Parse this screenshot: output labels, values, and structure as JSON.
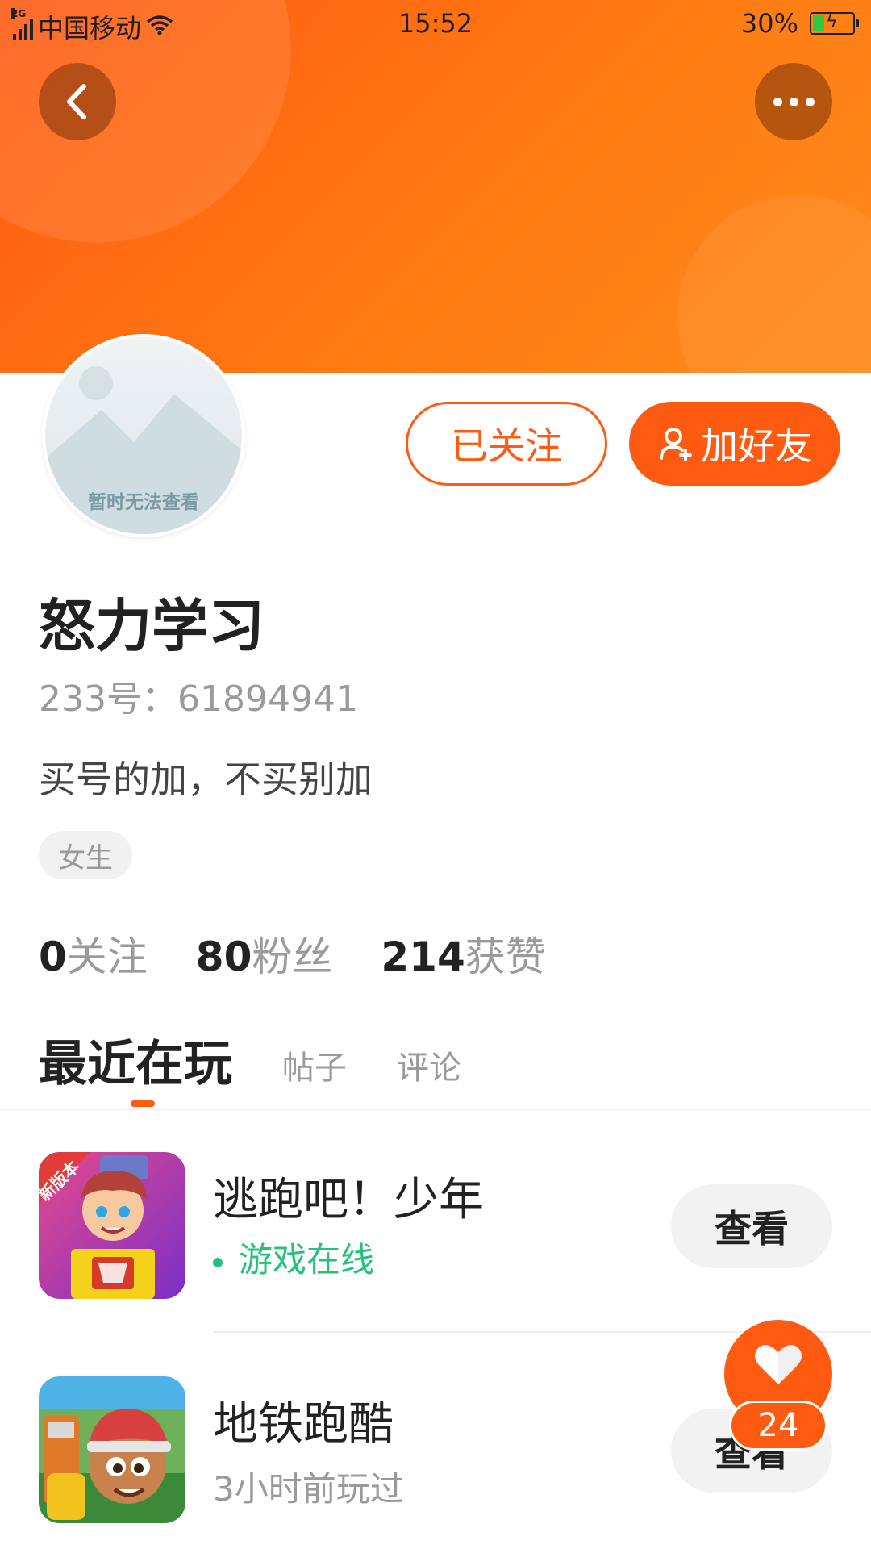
{
  "status_bar": {
    "network": "2G",
    "carrier": "中国移动",
    "time": "15:52",
    "battery": "30%"
  },
  "header": {
    "back_icon": "chevron-left-icon",
    "more_icon": "more-dots-icon",
    "color_start": "#ff5a12",
    "color_end": "#ff8c1e"
  },
  "profile": {
    "avatar_placeholder": "暂时无法查看",
    "follow_button": "已关注",
    "add_friend_button": "加好友",
    "username": "怒力学习",
    "uid": "233号：61894941",
    "bio": "买号的加，不买别加",
    "tag": "女生",
    "stats": [
      {
        "num": "0",
        "label": "关注"
      },
      {
        "num": "80",
        "label": "粉丝"
      },
      {
        "num": "214",
        "label": "获赞"
      }
    ]
  },
  "tabs": {
    "active": "最近在玩",
    "posts": "帖子",
    "comments": "评论"
  },
  "games": [
    {
      "title": "逃跑吧！少年",
      "status": "游戏在线",
      "status_color": "#25c27a",
      "button": "查看",
      "badge": "新版本"
    },
    {
      "title": "地铁跑酷",
      "status": "3小时前玩过",
      "status_color": "#9a9a9a",
      "button": "查看"
    }
  ],
  "like": {
    "icon": "heart-icon",
    "count": "24",
    "accent": "#ff5a12"
  }
}
